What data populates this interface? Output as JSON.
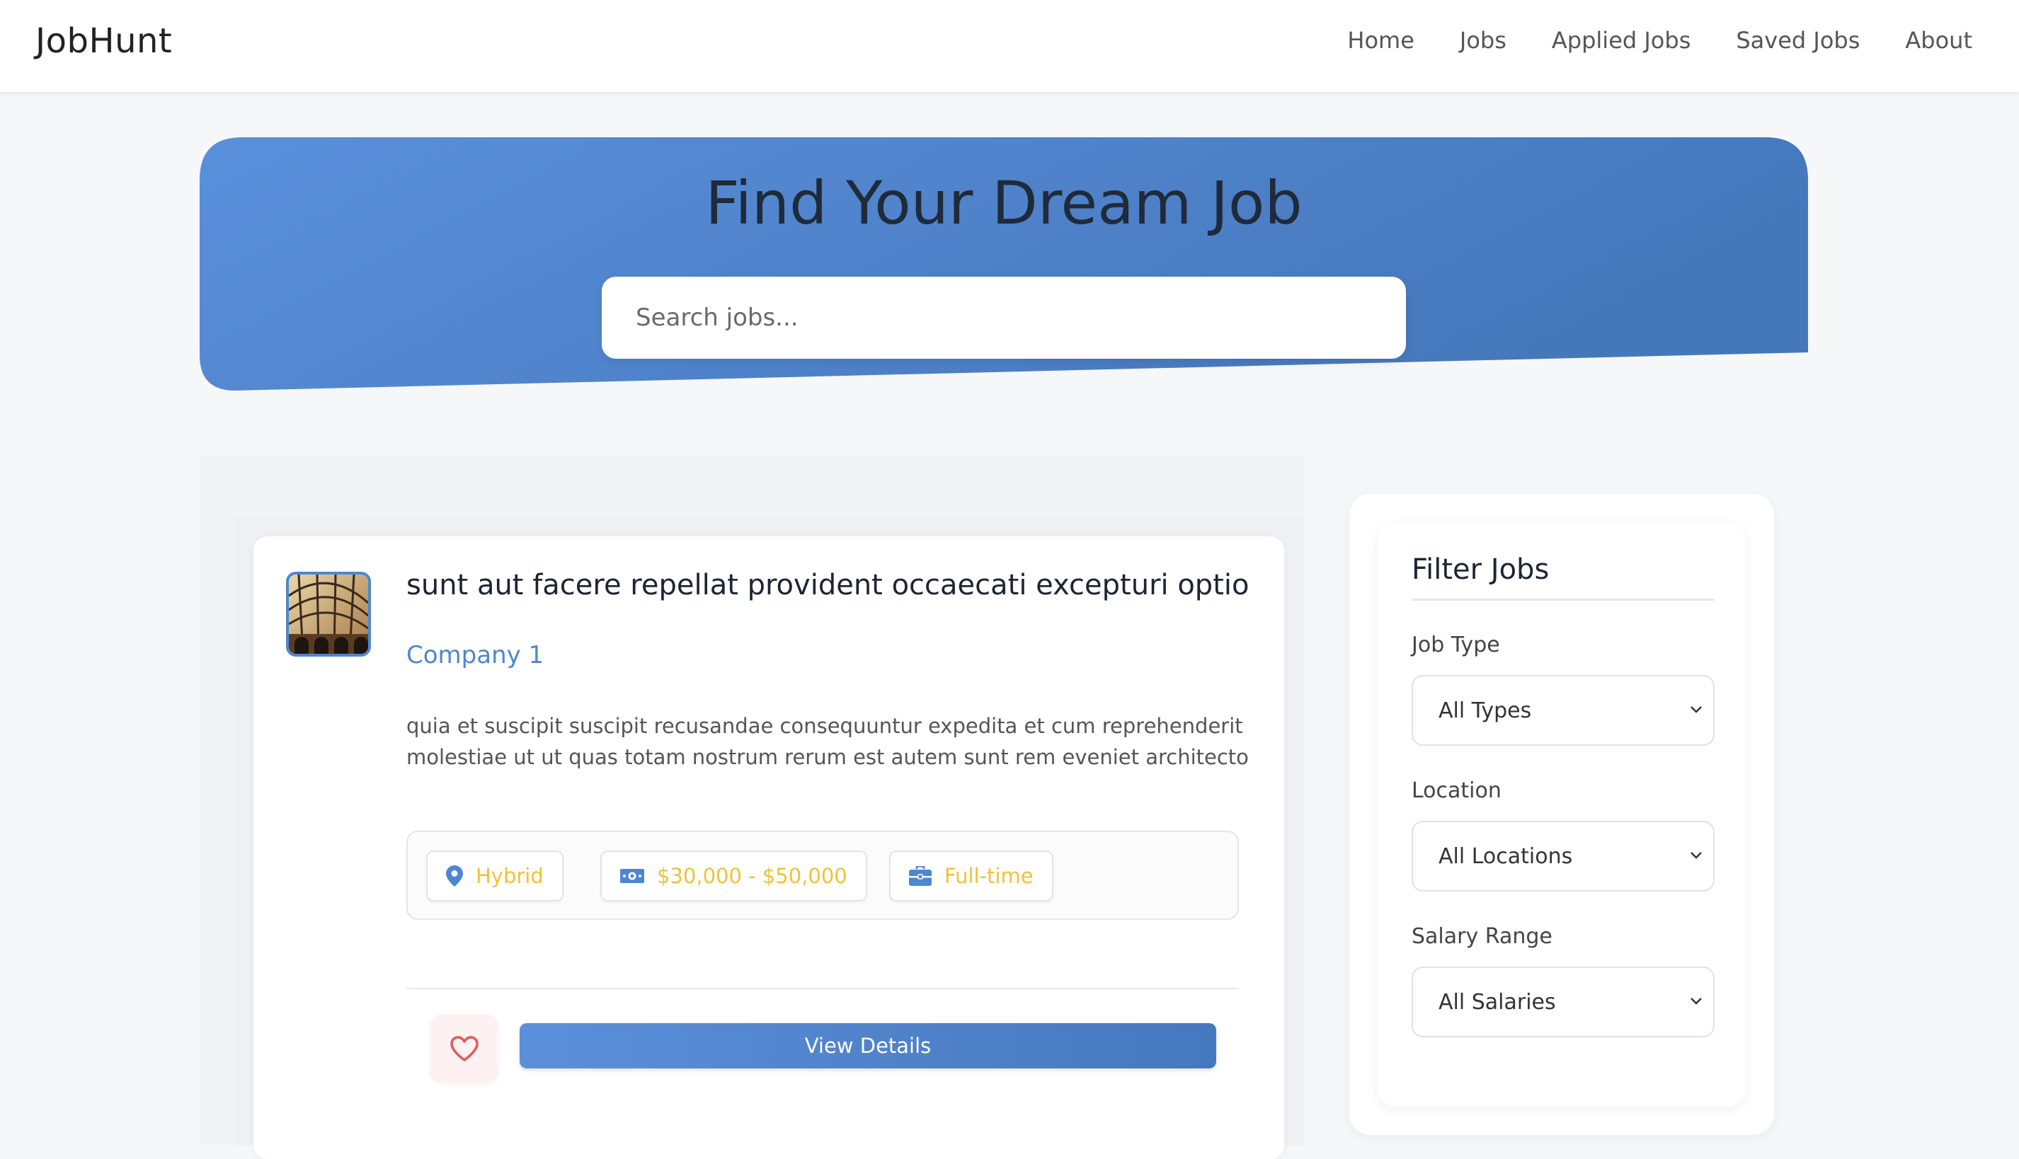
{
  "brand": "JobHunt",
  "nav": {
    "items": [
      {
        "label": "Home"
      },
      {
        "label": "Jobs"
      },
      {
        "label": "Applied Jobs"
      },
      {
        "label": "Saved Jobs"
      },
      {
        "label": "About"
      }
    ]
  },
  "hero": {
    "title": "Find Your Dream Job",
    "search_placeholder": "Search jobs..."
  },
  "job": {
    "title": "sunt aut facere repellat provident occaecati excepturi optio ...",
    "company": "Company 1",
    "description": "quia et suscipit suscipit recusandae consequuntur expedita et cum reprehenderit molestiae ut ut quas totam nostrum rerum est autem sunt rem eveniet architecto",
    "tags": {
      "location": "Hybrid",
      "salary": "$30,000 - $50,000",
      "type": "Full-time"
    },
    "details_label": "View Details"
  },
  "filters": {
    "title": "Filter Jobs",
    "job_type": {
      "label": "Job Type",
      "value": "All Types"
    },
    "location": {
      "label": "Location",
      "value": "All Locations"
    },
    "salary": {
      "label": "Salary Range",
      "value": "All Salaries"
    }
  },
  "colors": {
    "accent": "#4d86d2",
    "tag_text": "#f0c23a",
    "heart": "#e05a5a"
  },
  "icons": [
    "location-pin-icon",
    "money-icon",
    "briefcase-icon",
    "heart-icon",
    "chevron-down-icon"
  ]
}
